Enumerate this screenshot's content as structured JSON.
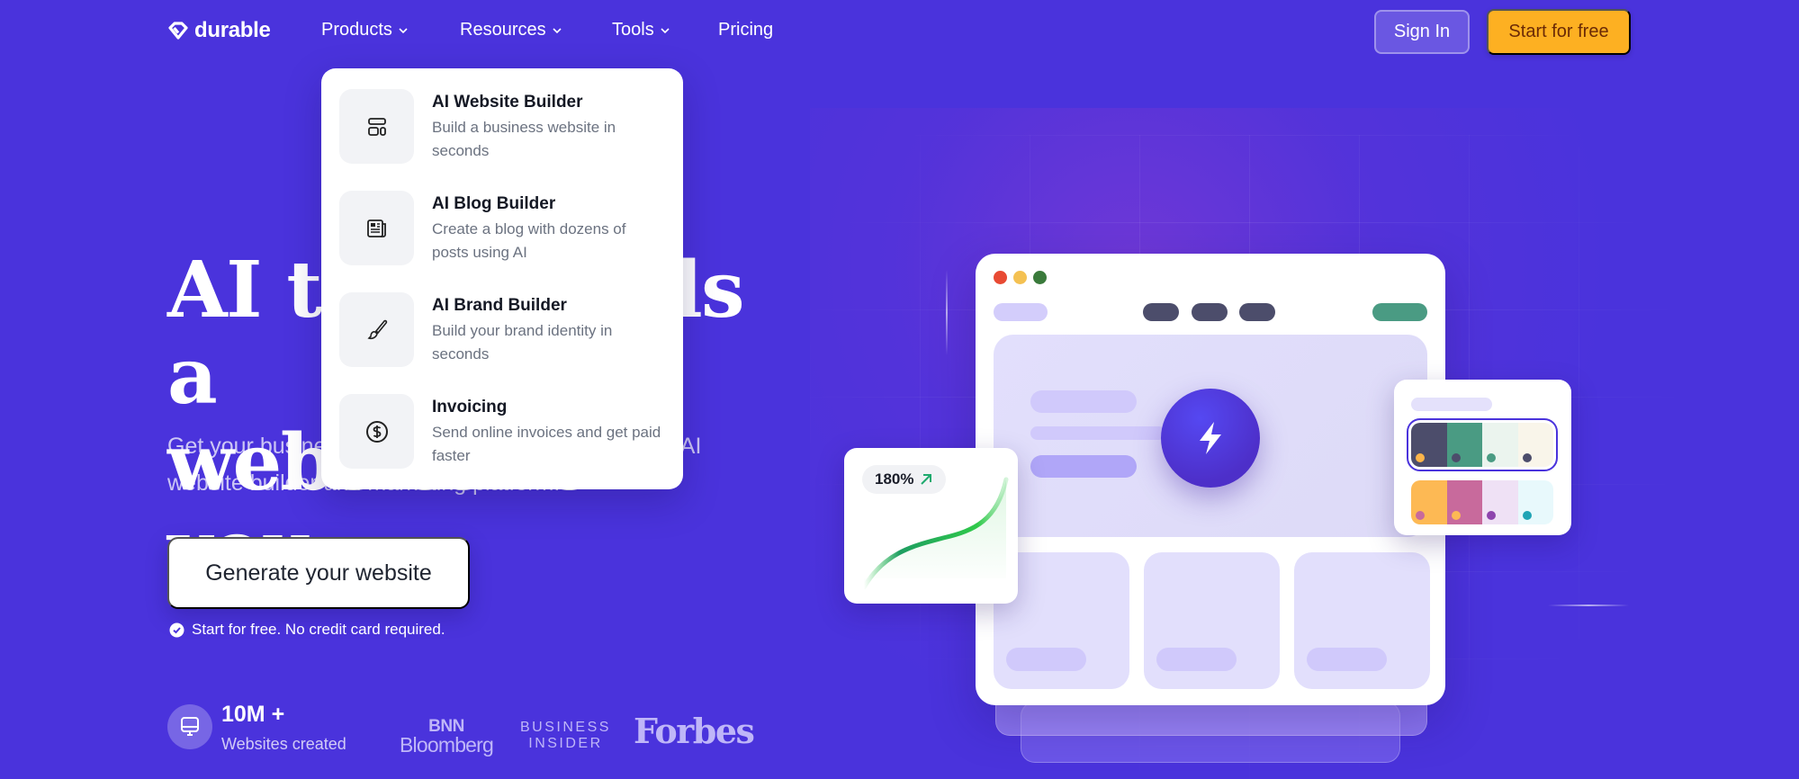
{
  "nav": {
    "logo_text": "durable",
    "items": [
      {
        "label": "Products",
        "has_dropdown": true
      },
      {
        "label": "Resources",
        "has_dropdown": true
      },
      {
        "label": "Tools",
        "has_dropdown": true
      },
      {
        "label": "Pricing",
        "has_dropdown": false
      }
    ],
    "sign_in_label": "Sign In",
    "start_label": "Start for free"
  },
  "hero": {
    "headline_line1": "AI that builds a",
    "headline_line2": "website for you.",
    "subhead": "Get your business online in 30 seconds with the #1 AI website builder and marketing platform.",
    "cta_label": "Generate your website",
    "note": "Start for free. No credit card required.",
    "stat_value": "10M +",
    "stat_label": "Websites created",
    "press": {
      "bnn_line1": "BNN",
      "bnn_line2": "Bloomberg",
      "bi_line1": "BUSINESS",
      "bi_line2": "INSIDER",
      "forbes": "Forbes"
    }
  },
  "products_menu": {
    "items": [
      {
        "title": "AI Website Builder",
        "description": "Build a business website in seconds",
        "icon": "layout-icon"
      },
      {
        "title": "AI Blog Builder",
        "description": "Create a blog with dozens of posts using AI",
        "icon": "newspaper-icon"
      },
      {
        "title": "AI Brand Builder",
        "description": "Build your brand identity in seconds",
        "icon": "paintbrush-icon"
      },
      {
        "title": "Invoicing",
        "description": "Send online invoices and get paid faster",
        "icon": "dollar-circle-icon"
      }
    ]
  },
  "illustration": {
    "growth_badge": "180%",
    "colors": {
      "brand": "#4a33dc",
      "accent_button": "#fdb022",
      "window_red": "#e84a33",
      "window_yellow": "#f4c152",
      "window_green": "#3a7a3b",
      "nav_dark": "#4c4d6b",
      "nav_green": "#4a9b83",
      "growth_green": "#2fc94a"
    },
    "palettes": [
      {
        "selected": true,
        "swatches": [
          {
            "bg": "#4c4d6b",
            "dot": "#fdb54a"
          },
          {
            "bg": "#4a9b83",
            "dot": "#4c4d6b"
          },
          {
            "bg": "#ebf4ee",
            "dot": "#4a9b83"
          },
          {
            "bg": "#f9f5ea",
            "dot": "#4c4d6b"
          }
        ]
      },
      {
        "selected": false,
        "swatches": [
          {
            "bg": "#fdb954",
            "dot": "#c86a9c"
          },
          {
            "bg": "#c86a9c",
            "dot": "#fdb954"
          },
          {
            "bg": "#efe1f5",
            "dot": "#8e44ad"
          },
          {
            "bg": "#e8f9fc",
            "dot": "#20a4b5"
          }
        ]
      }
    ]
  }
}
